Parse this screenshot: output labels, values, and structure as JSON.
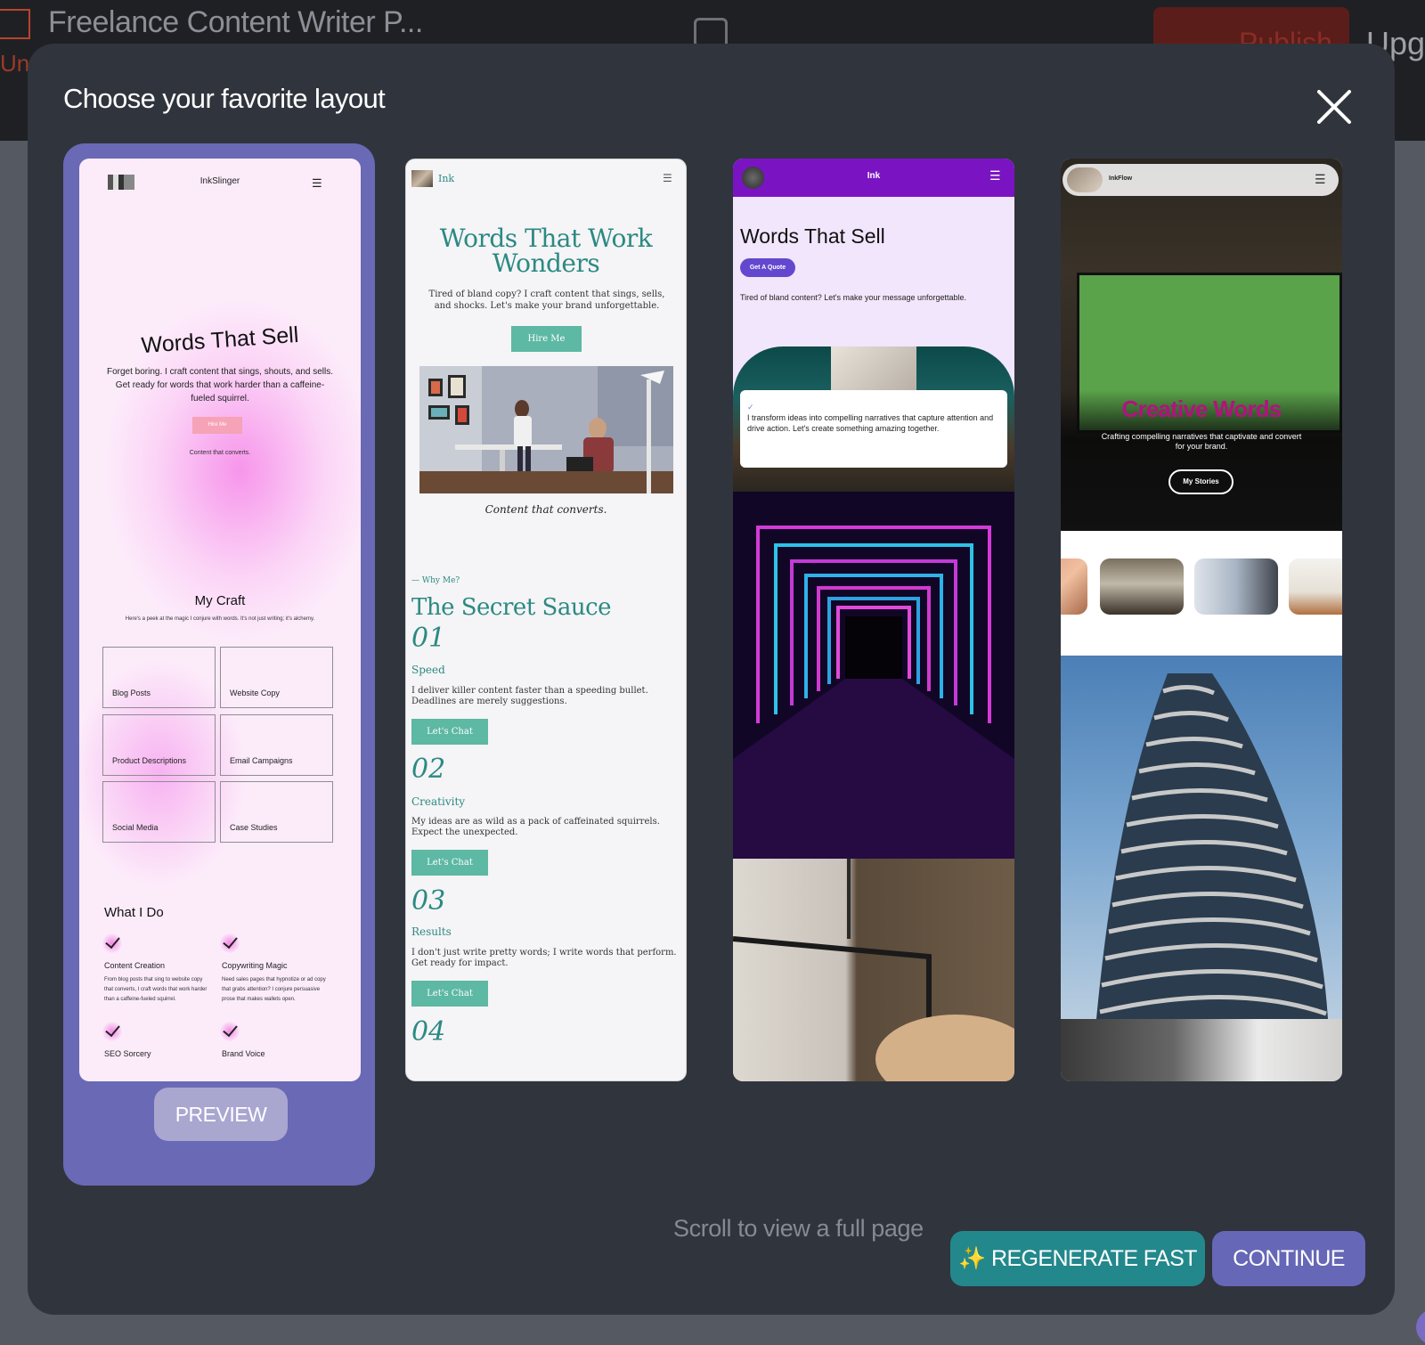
{
  "app": {
    "title": "Freelance Content Writer P...",
    "status": "Unp",
    "publish_label": "Publish",
    "upgrade_label": "Upgr"
  },
  "modal": {
    "title": "Choose your favorite layout",
    "close_icon": "close-icon",
    "preview_label": "PREVIEW",
    "hint": "Scroll to view a full page",
    "regenerate_label": "✨ REGENERATE FAST",
    "continue_label": "CONTINUE"
  },
  "colors": {
    "modal_bg": "#30343d",
    "selected_card": "#6a69b5",
    "regenerate": "#23888c",
    "continue": "#6667b7"
  },
  "layouts": [
    {
      "brand": "InkSlinger",
      "headline": "Words That Sell",
      "lead": "Forget boring. I craft content that sings, shouts, and sells. Get ready for words that work harder than a caffeine-fueled squirrel.",
      "cta": "Hire Me",
      "tagline": "Content that converts.",
      "section_title": "My Craft",
      "section_sub": "Here's a peek at the magic I conjure with words. It's not just writing; it's alchemy.",
      "boxes": [
        "Blog Posts",
        "Website Copy",
        "Product Descriptions",
        "Email Campaigns",
        "Social Media",
        "Case Studies"
      ],
      "services_title": "What I Do",
      "services": [
        {
          "title": "Content Creation",
          "desc": "From blog posts that sing to website copy that converts, I craft words that work harder than a caffeine-fueled squirrel."
        },
        {
          "title": "Copywriting Magic",
          "desc": "Need sales pages that hypnotize or ad copy that grabs attention? I conjure persuasive prose that makes wallets open."
        },
        {
          "title": "SEO Sorcery",
          "desc": ""
        },
        {
          "title": "Brand Voice",
          "desc": ""
        }
      ]
    },
    {
      "brand": "Ink",
      "headline": "Words That Work Wonders",
      "lead": "Tired of bland copy? I craft content that sings, sells, and shocks. Let's make your brand unforgettable.",
      "cta": "Hire Me",
      "tagline": "Content that converts.",
      "kicker": "— Why Me?",
      "section_title": "The Secret Sauce",
      "features": [
        {
          "num": "01",
          "title": "Speed",
          "desc": "I deliver killer content faster than a speeding bullet. Deadlines are merely suggestions.",
          "cta": "Let's Chat"
        },
        {
          "num": "02",
          "title": "Creativity",
          "desc": "My ideas are as wild as a pack of caffeinated squirrels. Expect the unexpected.",
          "cta": "Let's Chat"
        },
        {
          "num": "03",
          "title": "Results",
          "desc": "I don't just write pretty words; I write words that perform. Get ready for impact.",
          "cta": "Let's Chat"
        },
        {
          "num": "04"
        }
      ]
    },
    {
      "brand": "Ink",
      "headline": "Words That Sell",
      "cta": "Get A Quote",
      "lead": "Tired of bland content? Let's make your message unforgettable.",
      "quote": "I transform ideas into compelling narratives that capture attention and drive action. Let's create something amazing together."
    },
    {
      "brand": "InkFlow",
      "headline": "Creative Words",
      "lead": "Crafting compelling narratives that captivate and convert for your brand.",
      "cta": "My Stories"
    }
  ]
}
